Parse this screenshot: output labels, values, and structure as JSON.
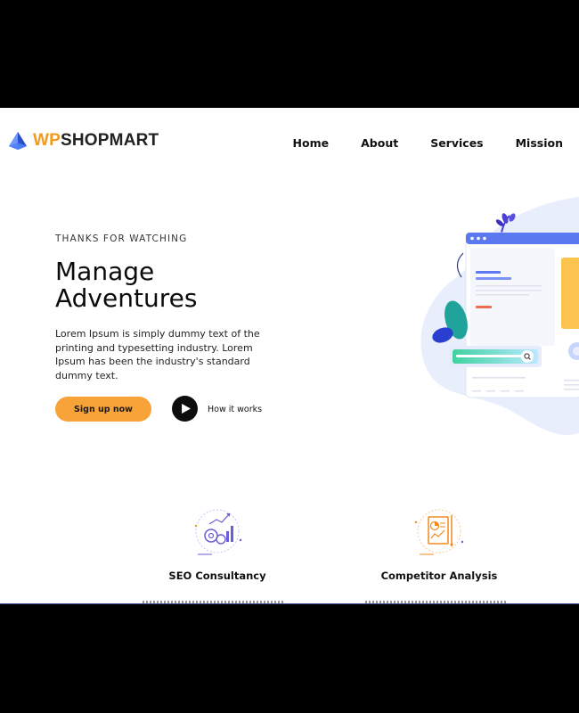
{
  "brand": {
    "prefix": "WP",
    "suffix": "SHOPMART",
    "accent": "#f49a1f",
    "logo_icon": "pyramid-logo-icon"
  },
  "nav": {
    "items": [
      {
        "label": "Home"
      },
      {
        "label": "About"
      },
      {
        "label": "Services"
      },
      {
        "label": "Mission"
      }
    ]
  },
  "hero": {
    "eyebrow": "THANKS FOR WATCHING",
    "headline_line1": "Manage",
    "headline_line2": "Adventures",
    "description": "Lorem Ipsum is simply dummy text of the printing and typesetting industry. Lorem Ipsum has been the industry's standard dummy text.",
    "cta_label": "Sign up now",
    "cta_color": "#f8a33a",
    "secondary_label": "How it works"
  },
  "features": [
    {
      "title": "SEO Consultancy",
      "icon": "seo-gears-chart-icon"
    },
    {
      "title": "Competitor Analysis",
      "icon": "report-document-icon"
    }
  ]
}
